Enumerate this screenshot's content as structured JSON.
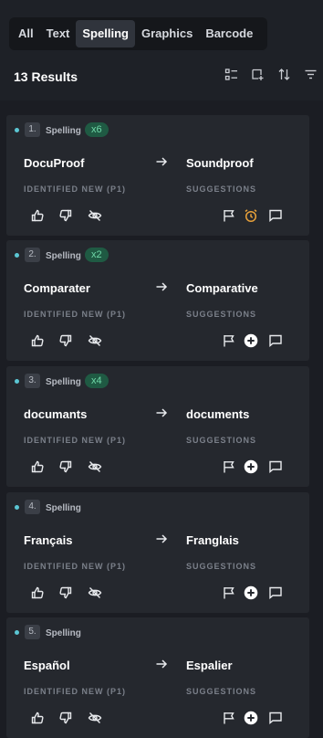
{
  "tabs": [
    {
      "label": "All"
    },
    {
      "label": "Text"
    },
    {
      "label": "Spelling"
    },
    {
      "label": "Graphics"
    },
    {
      "label": "Barcode"
    }
  ],
  "active_tab": "Spelling",
  "results_label": "13 Results",
  "colors": {
    "accent_dot": "#5bc6d3",
    "count_badge_bg": "#1f5a43",
    "count_badge_text": "#6fd8a8",
    "alarm": "#e8a13a"
  },
  "cards": [
    {
      "number": "1.",
      "kind": "Spelling",
      "count": "x6",
      "word": "DocuProof",
      "suggestion": "Soundproof",
      "left_label": "IDENTIFIED NEW (P1)",
      "right_label": "SUGGESTIONS",
      "right_icon": "alarm-clock-icon"
    },
    {
      "number": "2.",
      "kind": "Spelling",
      "count": "x2",
      "word": "Comparater",
      "suggestion": "Comparative",
      "left_label": "IDENTIFIED NEW (P1)",
      "right_label": "SUGGESTIONS",
      "right_icon": "add-circle-icon"
    },
    {
      "number": "3.",
      "kind": "Spelling",
      "count": "x4",
      "word": "documants",
      "suggestion": "documents",
      "left_label": "IDENTIFIED NEW (P1)",
      "right_label": "SUGGESTIONS",
      "right_icon": "add-circle-icon"
    },
    {
      "number": "4.",
      "kind": "Spelling",
      "count": "",
      "word": "Français",
      "suggestion": "Franglais",
      "left_label": "IDENTIFIED NEW (P1)",
      "right_label": "SUGGESTIONS",
      "right_icon": "add-circle-icon"
    },
    {
      "number": "5.",
      "kind": "Spelling",
      "count": "",
      "word": "Español",
      "suggestion": "Espalier",
      "left_label": "IDENTIFIED NEW (P1)",
      "right_label": "SUGGESTIONS",
      "right_icon": "add-circle-icon"
    }
  ]
}
